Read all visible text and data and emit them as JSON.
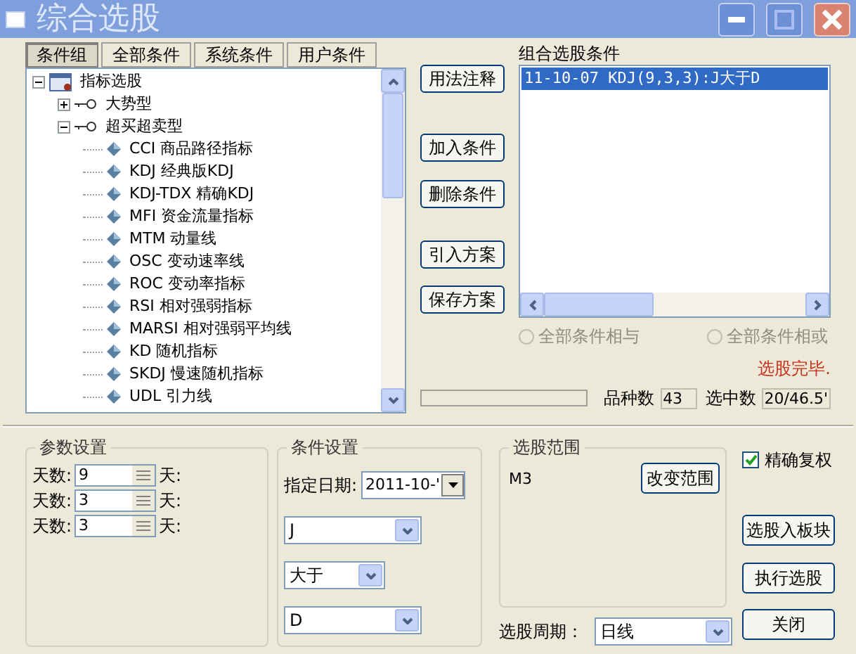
{
  "window": {
    "title": "综合选股"
  },
  "tabs": [
    {
      "label": "条件组",
      "selected": true
    },
    {
      "label": "全部条件",
      "selected": false
    },
    {
      "label": "系统条件",
      "selected": false
    },
    {
      "label": "用户条件",
      "selected": false
    }
  ],
  "tree": [
    {
      "label": "指标选股",
      "kind": "root",
      "expanded": true,
      "children": [
        {
          "label": "大势型",
          "kind": "group",
          "expanded": false
        },
        {
          "label": "超买超卖型",
          "kind": "group",
          "expanded": true,
          "children": [
            {
              "label": "CCI 商品路径指标",
              "kind": "leaf"
            },
            {
              "label": "KDJ 经典版KDJ",
              "kind": "leaf"
            },
            {
              "label": "KDJ-TDX 精确KDJ",
              "kind": "leaf"
            },
            {
              "label": "MFI 资金流量指标",
              "kind": "leaf"
            },
            {
              "label": "MTM 动量线",
              "kind": "leaf"
            },
            {
              "label": "OSC 变动速率线",
              "kind": "leaf"
            },
            {
              "label": "ROC 变动率指标",
              "kind": "leaf"
            },
            {
              "label": "RSI 相对强弱指标",
              "kind": "leaf"
            },
            {
              "label": "MARSI 相对强弱平均线",
              "kind": "leaf"
            },
            {
              "label": "KD 随机指标",
              "kind": "leaf"
            },
            {
              "label": "SKDJ 慢速随机指标",
              "kind": "leaf"
            },
            {
              "label": "UDL 引力线",
              "kind": "leaf"
            }
          ]
        }
      ]
    }
  ],
  "side_buttons": [
    "用法注释",
    "加入条件",
    "删除条件",
    "引入方案",
    "保存方案"
  ],
  "conditions": {
    "label": "组合选股条件",
    "items": [
      {
        "text": "11-10-07 KDJ(9,3,3):J大于D",
        "selected": true
      }
    ]
  },
  "logic": [
    {
      "label": "全部条件相与",
      "selected": false,
      "disabled": true
    },
    {
      "label": "全部条件相或",
      "selected": false,
      "disabled": true
    }
  ],
  "status": "选股完毕.",
  "progress": {
    "level": 0
  },
  "counts": [
    {
      "label": "品种数",
      "value": "43"
    },
    {
      "label": "选中数",
      "value": "20/46.5'"
    }
  ],
  "params": {
    "title": "参数设置",
    "rows": [
      {
        "label": "天数:",
        "value": "9",
        "unit": "天:"
      },
      {
        "label": "天数:",
        "value": "3",
        "unit": "天:"
      },
      {
        "label": "天数:",
        "value": "3",
        "unit": "天:"
      }
    ]
  },
  "cond_settings": {
    "title": "条件设置",
    "date_label": "指定日期:",
    "date": "2011-10-'",
    "selects": [
      "J",
      "大于",
      "D"
    ]
  },
  "range": {
    "title": "选股范围",
    "value": "M3",
    "button": "改变范围"
  },
  "period": {
    "label": "选股周期：",
    "value": "日线"
  },
  "precise": {
    "label": "精确复权",
    "checked": true
  },
  "actions": [
    "选股入板块",
    "执行选股",
    "关闭"
  ]
}
